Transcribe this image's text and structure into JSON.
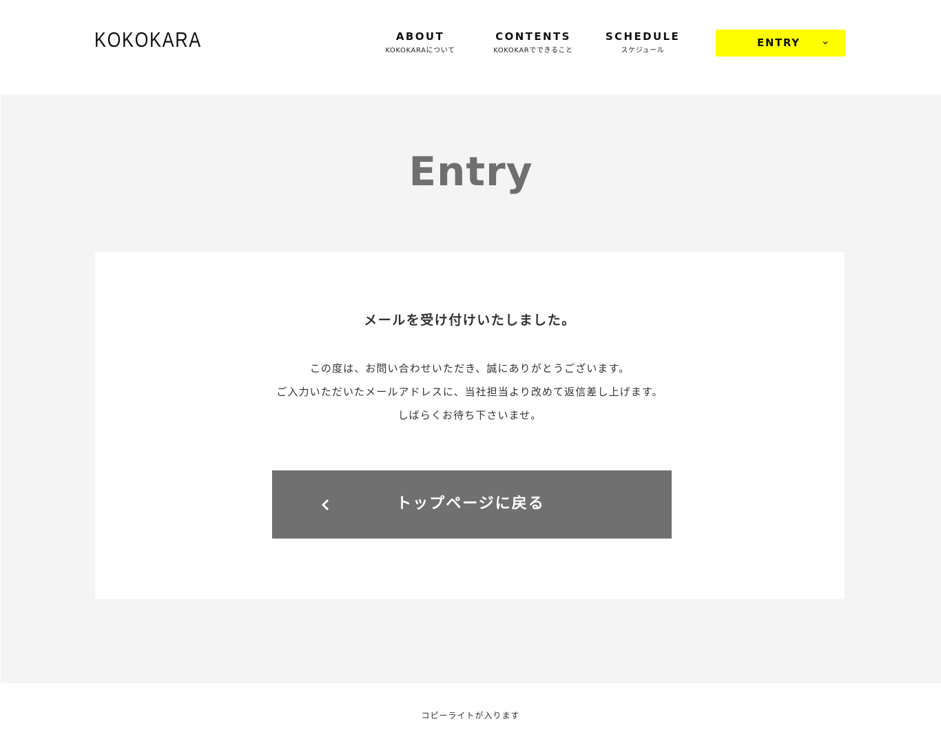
{
  "header": {
    "logo": "KOKOKARA",
    "nav": [
      {
        "label": "ABOUT",
        "sub": "KOKOKARAについて"
      },
      {
        "label": "CONTENTS",
        "sub": "KOKOKARでできること"
      },
      {
        "label": "SCHEDULE",
        "sub": "スケジュール"
      }
    ],
    "entry_button": {
      "label": "ENTRY",
      "icon": "chevron-down-icon"
    }
  },
  "main": {
    "title": "Entry",
    "card": {
      "heading": "メールを受け付けいたしました。",
      "body": [
        "この度は、お問い合わせいただき、誠にありがとうございます。",
        "ご入力いただいたメールアドレスに、当社担当より改めて返信差し上げます。",
        "しばらくお待ち下さいませ。"
      ],
      "back_button": {
        "label": "トップページに戻る",
        "icon": "chevron-left-icon"
      }
    }
  },
  "footer": {
    "copyright": "コピーライトが入ります"
  },
  "colors": {
    "accent": "#ffff00",
    "page_background": "#f4f4f4",
    "title": "#6f6f6f",
    "button": "#707070"
  }
}
